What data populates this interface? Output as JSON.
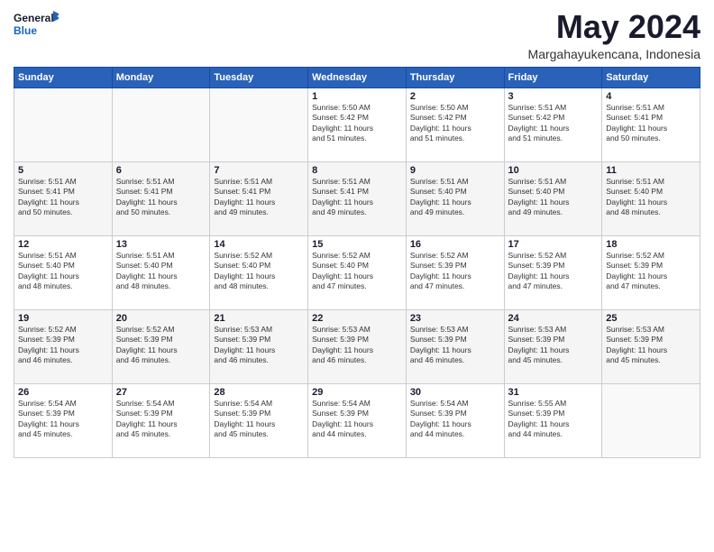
{
  "logo": {
    "line1": "General",
    "line2": "Blue"
  },
  "header": {
    "month": "May 2024",
    "location": "Margahayukencana, Indonesia"
  },
  "weekdays": [
    "Sunday",
    "Monday",
    "Tuesday",
    "Wednesday",
    "Thursday",
    "Friday",
    "Saturday"
  ],
  "weeks": [
    [
      {
        "day": "",
        "info": ""
      },
      {
        "day": "",
        "info": ""
      },
      {
        "day": "",
        "info": ""
      },
      {
        "day": "1",
        "info": "Sunrise: 5:50 AM\nSunset: 5:42 PM\nDaylight: 11 hours\nand 51 minutes."
      },
      {
        "day": "2",
        "info": "Sunrise: 5:50 AM\nSunset: 5:42 PM\nDaylight: 11 hours\nand 51 minutes."
      },
      {
        "day": "3",
        "info": "Sunrise: 5:51 AM\nSunset: 5:42 PM\nDaylight: 11 hours\nand 51 minutes."
      },
      {
        "day": "4",
        "info": "Sunrise: 5:51 AM\nSunset: 5:41 PM\nDaylight: 11 hours\nand 50 minutes."
      }
    ],
    [
      {
        "day": "5",
        "info": "Sunrise: 5:51 AM\nSunset: 5:41 PM\nDaylight: 11 hours\nand 50 minutes."
      },
      {
        "day": "6",
        "info": "Sunrise: 5:51 AM\nSunset: 5:41 PM\nDaylight: 11 hours\nand 50 minutes."
      },
      {
        "day": "7",
        "info": "Sunrise: 5:51 AM\nSunset: 5:41 PM\nDaylight: 11 hours\nand 49 minutes."
      },
      {
        "day": "8",
        "info": "Sunrise: 5:51 AM\nSunset: 5:41 PM\nDaylight: 11 hours\nand 49 minutes."
      },
      {
        "day": "9",
        "info": "Sunrise: 5:51 AM\nSunset: 5:40 PM\nDaylight: 11 hours\nand 49 minutes."
      },
      {
        "day": "10",
        "info": "Sunrise: 5:51 AM\nSunset: 5:40 PM\nDaylight: 11 hours\nand 49 minutes."
      },
      {
        "day": "11",
        "info": "Sunrise: 5:51 AM\nSunset: 5:40 PM\nDaylight: 11 hours\nand 48 minutes."
      }
    ],
    [
      {
        "day": "12",
        "info": "Sunrise: 5:51 AM\nSunset: 5:40 PM\nDaylight: 11 hours\nand 48 minutes."
      },
      {
        "day": "13",
        "info": "Sunrise: 5:51 AM\nSunset: 5:40 PM\nDaylight: 11 hours\nand 48 minutes."
      },
      {
        "day": "14",
        "info": "Sunrise: 5:52 AM\nSunset: 5:40 PM\nDaylight: 11 hours\nand 48 minutes."
      },
      {
        "day": "15",
        "info": "Sunrise: 5:52 AM\nSunset: 5:40 PM\nDaylight: 11 hours\nand 47 minutes."
      },
      {
        "day": "16",
        "info": "Sunrise: 5:52 AM\nSunset: 5:39 PM\nDaylight: 11 hours\nand 47 minutes."
      },
      {
        "day": "17",
        "info": "Sunrise: 5:52 AM\nSunset: 5:39 PM\nDaylight: 11 hours\nand 47 minutes."
      },
      {
        "day": "18",
        "info": "Sunrise: 5:52 AM\nSunset: 5:39 PM\nDaylight: 11 hours\nand 47 minutes."
      }
    ],
    [
      {
        "day": "19",
        "info": "Sunrise: 5:52 AM\nSunset: 5:39 PM\nDaylight: 11 hours\nand 46 minutes."
      },
      {
        "day": "20",
        "info": "Sunrise: 5:52 AM\nSunset: 5:39 PM\nDaylight: 11 hours\nand 46 minutes."
      },
      {
        "day": "21",
        "info": "Sunrise: 5:53 AM\nSunset: 5:39 PM\nDaylight: 11 hours\nand 46 minutes."
      },
      {
        "day": "22",
        "info": "Sunrise: 5:53 AM\nSunset: 5:39 PM\nDaylight: 11 hours\nand 46 minutes."
      },
      {
        "day": "23",
        "info": "Sunrise: 5:53 AM\nSunset: 5:39 PM\nDaylight: 11 hours\nand 46 minutes."
      },
      {
        "day": "24",
        "info": "Sunrise: 5:53 AM\nSunset: 5:39 PM\nDaylight: 11 hours\nand 45 minutes."
      },
      {
        "day": "25",
        "info": "Sunrise: 5:53 AM\nSunset: 5:39 PM\nDaylight: 11 hours\nand 45 minutes."
      }
    ],
    [
      {
        "day": "26",
        "info": "Sunrise: 5:54 AM\nSunset: 5:39 PM\nDaylight: 11 hours\nand 45 minutes."
      },
      {
        "day": "27",
        "info": "Sunrise: 5:54 AM\nSunset: 5:39 PM\nDaylight: 11 hours\nand 45 minutes."
      },
      {
        "day": "28",
        "info": "Sunrise: 5:54 AM\nSunset: 5:39 PM\nDaylight: 11 hours\nand 45 minutes."
      },
      {
        "day": "29",
        "info": "Sunrise: 5:54 AM\nSunset: 5:39 PM\nDaylight: 11 hours\nand 44 minutes."
      },
      {
        "day": "30",
        "info": "Sunrise: 5:54 AM\nSunset: 5:39 PM\nDaylight: 11 hours\nand 44 minutes."
      },
      {
        "day": "31",
        "info": "Sunrise: 5:55 AM\nSunset: 5:39 PM\nDaylight: 11 hours\nand 44 minutes."
      },
      {
        "day": "",
        "info": ""
      }
    ]
  ]
}
